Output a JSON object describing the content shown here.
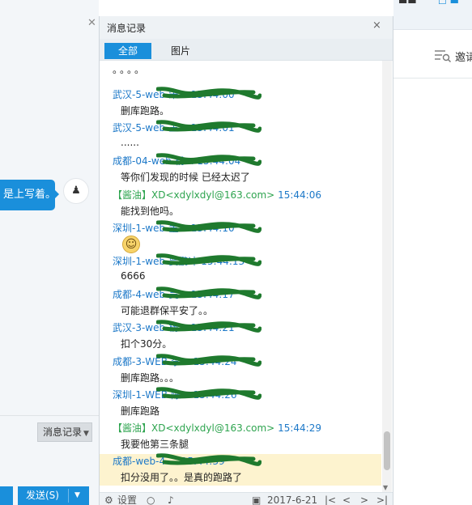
{
  "left_panel": {
    "bubble_text": "是上写着。",
    "avatar_glyph": "♟",
    "history_button": "消息记录",
    "send_button": "发送(S)"
  },
  "history_panel": {
    "title": "消息记录",
    "close": "×",
    "filters": [
      "全部",
      "图片"
    ],
    "clipped_text": "。。。。",
    "messages": [
      {
        "sender": "武汉-5-web-宋...",
        "time": "15:44:00",
        "text": "删库跑路。"
      },
      {
        "sender": "武汉-5-web-王...",
        "time": "15:44:01",
        "text": "......"
      },
      {
        "sender": "成都-04-web-杨...",
        "time": "15:44:04",
        "text": "等你们发现的时候 已经太迟了"
      },
      {
        "sender": "【酱油】XD<xdylxdyl@163.com>",
        "time": "15:44:06",
        "text": "能找到他吗。",
        "tag": "xd"
      },
      {
        "sender": "深圳-1-web-董...",
        "time": "15:44:10",
        "text": "",
        "emoji": "☺"
      },
      {
        "sender": "深圳-1-web-贾鹏冲",
        "time": "15:44:13",
        "text": "6666"
      },
      {
        "sender": "成都-4-web-吴...",
        "time": "15:44:17",
        "text": "可能退群保平安了。。"
      },
      {
        "sender": "武汉-3-web-杨...",
        "time": "15:44:21",
        "text": "扣个30分。"
      },
      {
        "sender": "成都-3-WEB-李...",
        "time": "15:44:24",
        "text": "删库跑路。。。"
      },
      {
        "sender": "深圳-1-WEB-陈...",
        "time": "15:44:26",
        "text": "删库跑路"
      },
      {
        "sender": "【酱油】XD<xdylxdyl@163.com>",
        "time": "15:44:29",
        "text": "我要他第三条腿",
        "tag": "xd"
      },
      {
        "sender": "成都-web-4-...",
        "time": "15:44:39",
        "text": "扣分没用了。。是真的跑路了",
        "highlight": true
      }
    ],
    "toolbar": {
      "settings": "设置",
      "date": "2017-6-21"
    }
  },
  "right_panel": {
    "invite": "邀请"
  },
  "colors": {
    "accent": "#1a8fdb",
    "sender_blue": "#1c78c8",
    "scribble_green": "#1f7a2e",
    "highlight_row": "#fdf3cf"
  }
}
